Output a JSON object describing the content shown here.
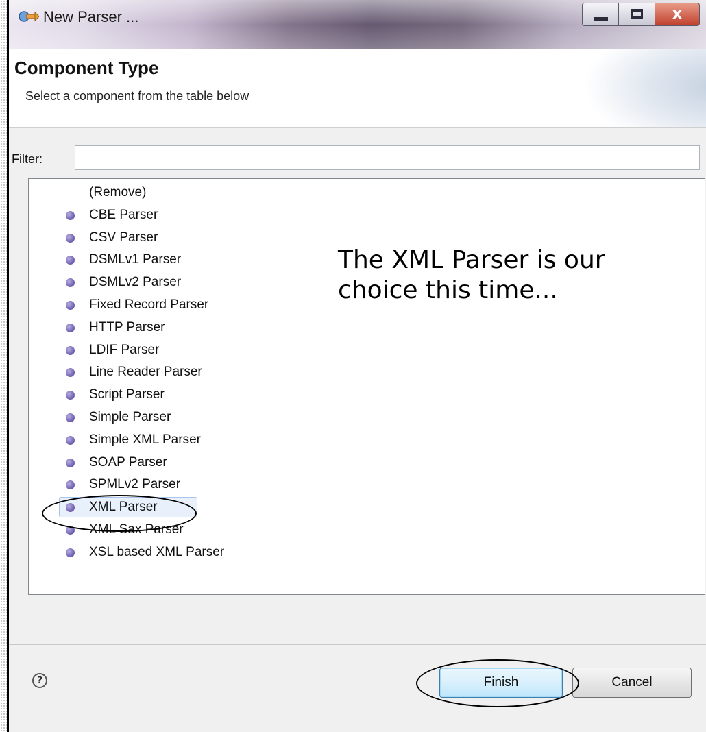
{
  "window": {
    "title": "New Parser ...",
    "controls": {
      "minimize": "–",
      "maximize": "□",
      "close": "x"
    }
  },
  "header": {
    "title": "Component Type",
    "subtitle": "Select a component from the table below"
  },
  "filter": {
    "label": "Filter:",
    "value": ""
  },
  "components": {
    "items": [
      {
        "label": "(Remove)",
        "bullet": false
      },
      {
        "label": "CBE Parser",
        "bullet": true
      },
      {
        "label": "CSV Parser",
        "bullet": true
      },
      {
        "label": "DSMLv1 Parser",
        "bullet": true
      },
      {
        "label": "DSMLv2 Parser",
        "bullet": true
      },
      {
        "label": "Fixed Record Parser",
        "bullet": true
      },
      {
        "label": "HTTP Parser",
        "bullet": true
      },
      {
        "label": "LDIF Parser",
        "bullet": true
      },
      {
        "label": "Line Reader Parser",
        "bullet": true
      },
      {
        "label": "Script Parser",
        "bullet": true
      },
      {
        "label": "Simple Parser",
        "bullet": true
      },
      {
        "label": "Simple XML Parser",
        "bullet": true
      },
      {
        "label": "SOAP Parser",
        "bullet": true
      },
      {
        "label": "SPMLv2 Parser",
        "bullet": true
      },
      {
        "label": "XML Parser",
        "bullet": true,
        "selected": true
      },
      {
        "label": "XML Sax Parser",
        "bullet": true
      },
      {
        "label": "XSL based XML Parser",
        "bullet": true
      }
    ]
  },
  "annotation": {
    "line1": "The XML Parser is our",
    "line2": "choice this time..."
  },
  "footer": {
    "help": "?",
    "finish_label": "Finish",
    "cancel_label": "Cancel"
  },
  "colors": {
    "bullet": "#7a6cb8",
    "selection_bg": "#e8f0fb",
    "finish_border": "#3c7fb1"
  }
}
